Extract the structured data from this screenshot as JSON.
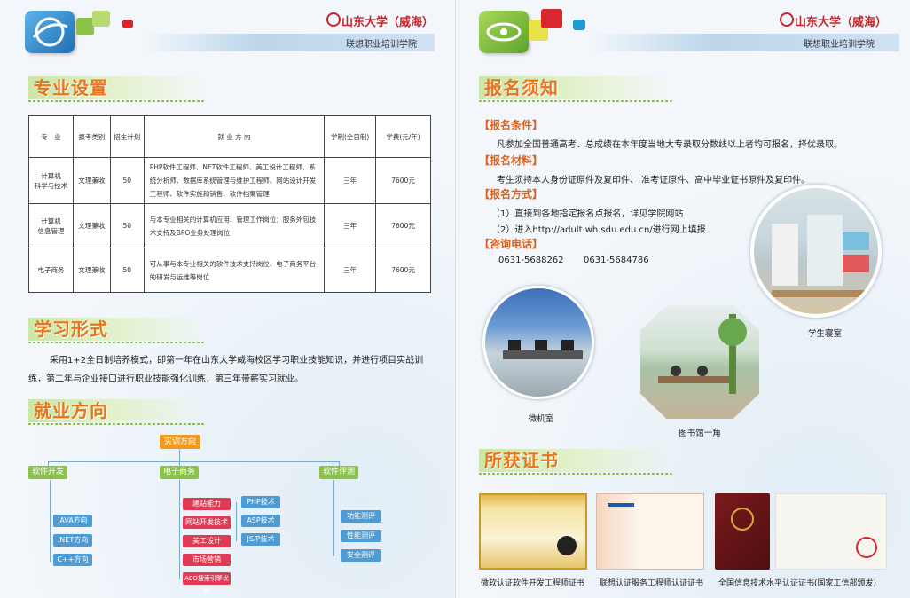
{
  "header": {
    "university": "山东大学（威海）",
    "college": "联想职业培训学院"
  },
  "left": {
    "sec1": "专业设置",
    "table": {
      "headers": [
        "专　业",
        "报考类别",
        "招生计划",
        "就 业 方 向",
        "学制(全日制)",
        "学费(元/年)"
      ],
      "rows": [
        {
          "major1": "计算机",
          "major2": "科学与技术",
          "type": "文理兼收",
          "plan": "50",
          "dir": "PHP软件工程师、NET软件工程师、美工设计工程师、系统分析师、数据库系统管理与维护工程师、网站设计开发工程师、软件实施和销售、软件档案管理",
          "years": "三年",
          "fee": "7600元"
        },
        {
          "major1": "计算机",
          "major2": "信息管理",
          "type": "文理兼收",
          "plan": "50",
          "dir": "与本专业相关的计算机应用、管理工作岗位；服务外包技术支持及BPO业务处理岗位",
          "years": "三年",
          "fee": "7600元"
        },
        {
          "major1": "电子商务",
          "major2": "",
          "type": "文理兼收",
          "plan": "50",
          "dir": "可从事与本专业相关的软件技术支持岗位、电子商务平台的研发与运维等岗位",
          "years": "三年",
          "fee": "7600元"
        }
      ]
    },
    "sec2": "学习形式",
    "study": "采用1+2全日制培养模式，即第一年在山东大学威海校区学习职业技能知识，并进行项目实战训练，第二年与企业接口进行职业技能强化训练，第三年带薪实习就业。",
    "sec3": "就业方向",
    "tree": {
      "root": "实训方向",
      "branches": [
        "软件开发",
        "电子商务",
        "软件评测"
      ],
      "dev": [
        "JAVA方向",
        ".NET方向",
        "C++方向"
      ],
      "ecom_a": [
        "建站能力",
        "网站开发技术",
        "美工设计",
        "市场营销",
        "AEO搜索引擎优化"
      ],
      "ecom_b": [
        "PHP技术",
        "ASP技术",
        "JS/P技术"
      ],
      "test": [
        "功能测评",
        "性能测评",
        "安全测评"
      ]
    }
  },
  "right": {
    "sec1": "报名须知",
    "cond_h": "【报名条件】",
    "cond_t": "凡参加全国普通高考、总成绩在本年度当地大专录取分数线以上者均可报名，择优录取。",
    "mat_h": "【报名材料】",
    "mat_t": "考生须持本人身份证原件及复印件、 准考证原件、高中毕业证书原件及复印件。",
    "way_h": "【报名方式】",
    "way_1": "（1）直接到各地指定报名点报名，详见学院网站",
    "way_2": "（2）进入http://adult.wh.sdu.edu.cn/进行网上填报",
    "tel_h": "【咨询电话】",
    "tel_1": "0631-5688262",
    "tel_2": "0631-5684786",
    "photos": [
      "学生寝室",
      "微机室",
      "图书馆一角"
    ],
    "sec2": "所获证书",
    "certs": [
      "微软认证软件开发工程师证书",
      "联想认证服务工程师认证证书",
      "全国信息技术水平认证证书(国家工信部颁发)"
    ]
  }
}
